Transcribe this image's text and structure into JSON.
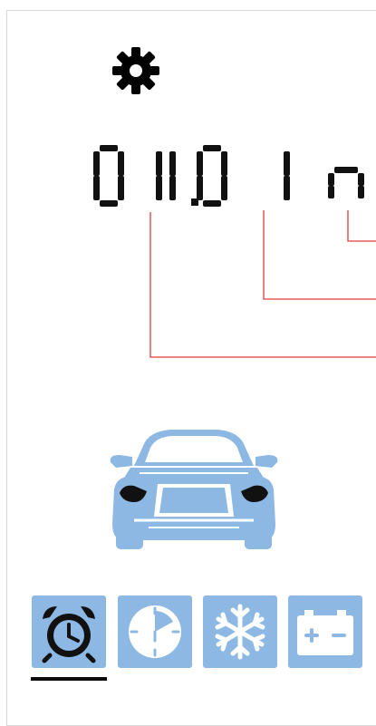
{
  "display": {
    "segments": [
      "0",
      "1",
      "1",
      "0",
      "1",
      "n"
    ],
    "decimal_after_index": 2,
    "readout": "01.01 m"
  },
  "tabs": [
    {
      "id": "alarm",
      "icon": "alarm-clock-icon",
      "active": true
    },
    {
      "id": "timer",
      "icon": "clock-timer-icon",
      "active": false
    },
    {
      "id": "climate",
      "icon": "snowflake-icon",
      "active": false
    },
    {
      "id": "battery",
      "icon": "battery-icon",
      "active": false
    }
  ],
  "colors": {
    "segment": "#111111",
    "callout": "#e23c3c",
    "accent": "#8db8e3",
    "active_indicator": "#0a0a0a"
  }
}
